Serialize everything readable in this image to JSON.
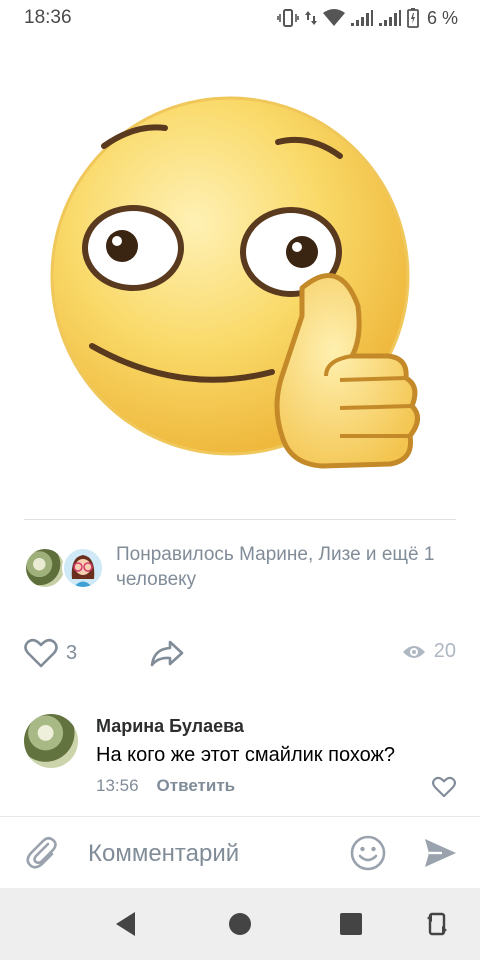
{
  "status_bar": {
    "time": "18:36",
    "battery_percent": "6 %",
    "icons": [
      "vibrate-icon",
      "data-arrows-icon",
      "wifi-icon",
      "signal-icon",
      "signal-icon",
      "battery-icon"
    ]
  },
  "post": {
    "sticker": "thumbs-up-smiley-sticker",
    "likes_summary": "Понравилось Марине, Лизе и ещё 1 человеку",
    "likes_count": "3",
    "views_count": "20"
  },
  "comment": {
    "author": "Марина Булаева",
    "text": "На кого же этот смайлик похож?",
    "time": "13:56",
    "reply_label": "Ответить"
  },
  "input": {
    "placeholder": "Комментарий"
  },
  "colors": {
    "accent_gray": "#818c99",
    "sticker_yellow": "#f7d35a",
    "nav_background": "#eeeeee"
  }
}
